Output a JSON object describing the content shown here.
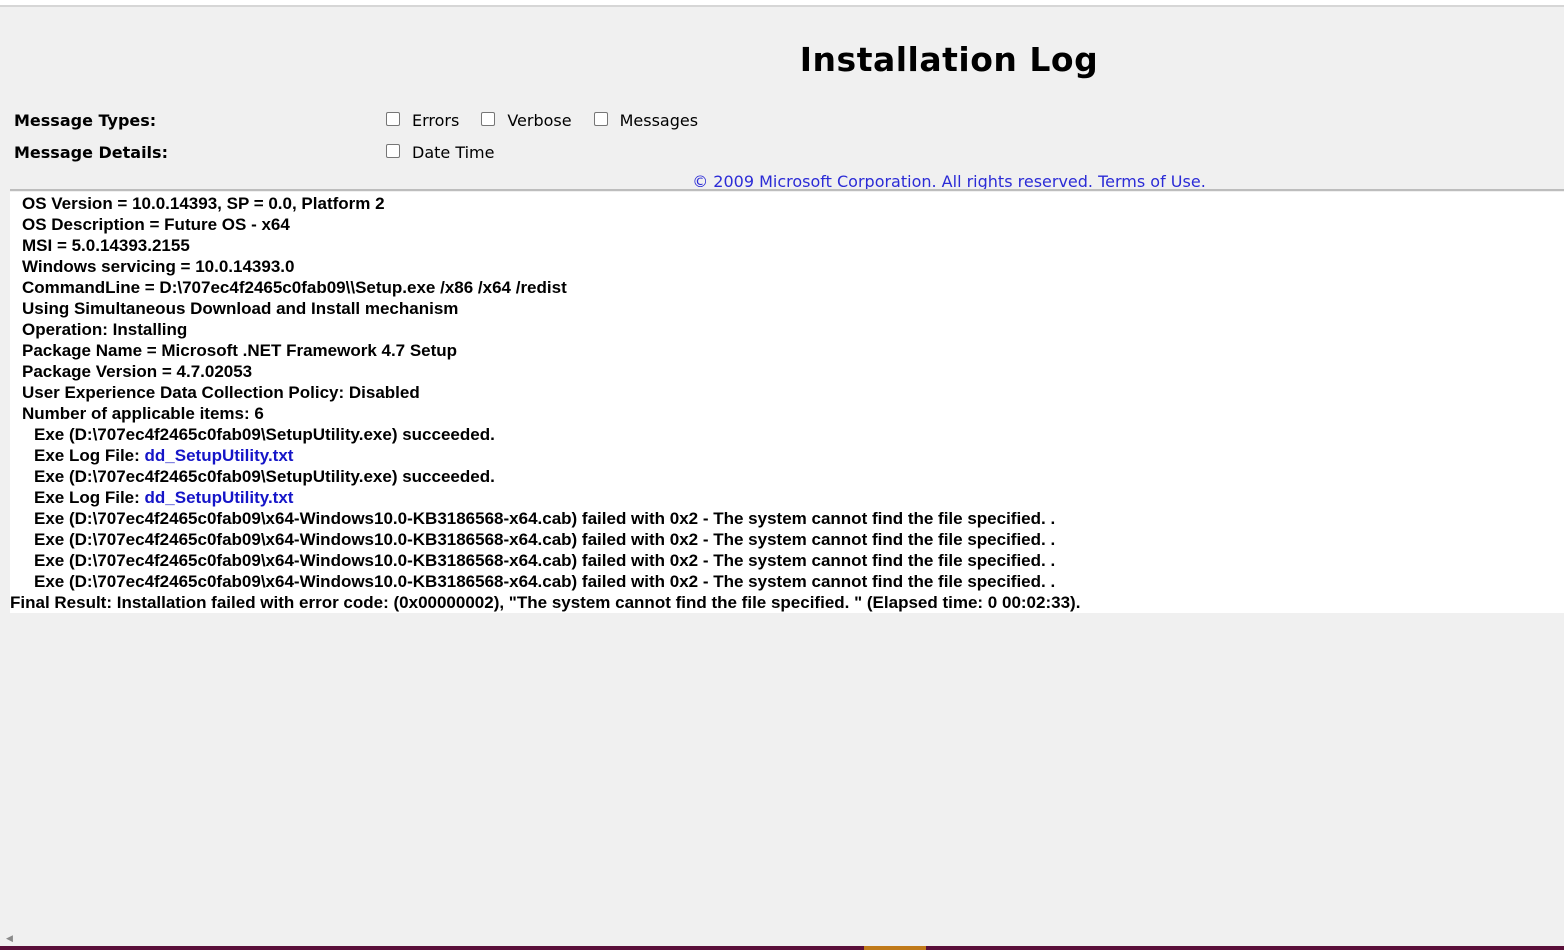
{
  "page_title": "Installation Log",
  "filters": {
    "message_types_label": "Message Types:",
    "message_details_label": "Message Details:",
    "types": [
      {
        "label": "Errors",
        "checked": false
      },
      {
        "label": "Verbose",
        "checked": false
      },
      {
        "label": "Messages",
        "checked": false
      }
    ],
    "details": [
      {
        "label": "Date Time",
        "checked": false
      }
    ]
  },
  "copyright": {
    "text": "© 2009 Microsoft Corporation. All rights reserved.",
    "terms_link": "Terms of Use."
  },
  "log": {
    "lines": [
      "OS Version = 10.0.14393, SP = 0.0, Platform 2",
      "OS Description = Future OS - x64",
      "MSI = 5.0.14393.2155",
      "Windows servicing = 10.0.14393.0",
      "CommandLine = D:\\707ec4f2465c0fab09\\\\Setup.exe /x86 /x64 /redist",
      "Using Simultaneous Download and Install mechanism",
      "Operation: Installing",
      "Package Name = Microsoft .NET Framework 4.7 Setup",
      "Package Version = 4.7.02053",
      "User Experience Data Collection Policy: Disabled",
      "Number of applicable items: 6"
    ],
    "items": [
      {
        "text": "Exe (D:\\707ec4f2465c0fab09\\SetupUtility.exe) succeeded."
      },
      {
        "prefix": "Exe Log File: ",
        "link": "dd_SetupUtility.txt"
      },
      {
        "text": "Exe (D:\\707ec4f2465c0fab09\\SetupUtility.exe) succeeded."
      },
      {
        "prefix": "Exe Log File: ",
        "link": "dd_SetupUtility.txt"
      },
      {
        "text": "Exe (D:\\707ec4f2465c0fab09\\x64-Windows10.0-KB3186568-x64.cab) failed with 0x2 - The system cannot find the file specified. ."
      },
      {
        "text": "Exe (D:\\707ec4f2465c0fab09\\x64-Windows10.0-KB3186568-x64.cab) failed with 0x2 - The system cannot find the file specified. ."
      },
      {
        "text": "Exe (D:\\707ec4f2465c0fab09\\x64-Windows10.0-KB3186568-x64.cab) failed with 0x2 - The system cannot find the file specified. ."
      },
      {
        "text": "Exe (D:\\707ec4f2465c0fab09\\x64-Windows10.0-KB3186568-x64.cab) failed with 0x2 - The system cannot find the file specified. ."
      }
    ],
    "final_result": "Final Result: Installation failed with error code: (0x00000002), \"The system cannot find the file specified. \" (Elapsed time: 0 00:02:33)."
  },
  "colors": {
    "background": "#f0f0f0",
    "log_background": "#ffffff",
    "link": "#1515c8"
  }
}
